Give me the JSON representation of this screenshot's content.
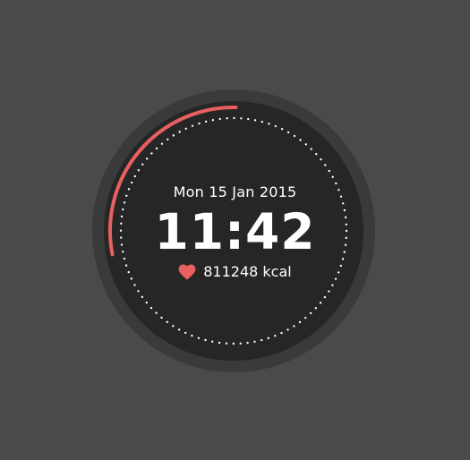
{
  "watch": {
    "date": "Mon 15 Jan 2015",
    "time": "11:42",
    "calories": "811248 kcal",
    "calorie_icon": "heart-icon",
    "progress_arc_fraction": 0.25
  },
  "colors": {
    "background": "#4a4a4a",
    "bezel": "#3a3a3a",
    "face": "#262626",
    "accent": "#e86060",
    "text": "#ffffff"
  }
}
